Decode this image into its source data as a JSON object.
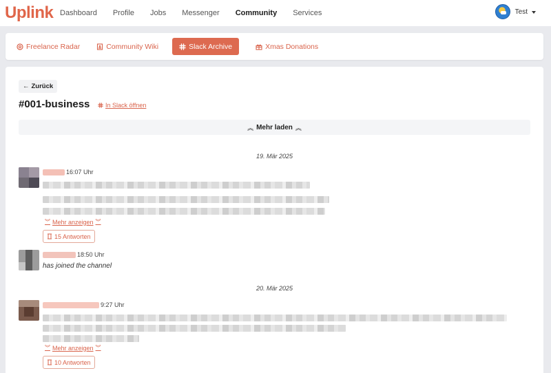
{
  "app": {
    "logo": "Uplink"
  },
  "nav": {
    "links": [
      "Dashboard",
      "Profile",
      "Jobs",
      "Messenger",
      "Community",
      "Services"
    ],
    "active": "Community",
    "user_name": "Test"
  },
  "tabs": [
    {
      "label": "Freelance Radar",
      "icon": "target-icon"
    },
    {
      "label": "Community Wiki",
      "icon": "book-icon"
    },
    {
      "label": "Slack Archive",
      "icon": "slack-icon",
      "active": true
    },
    {
      "label": "Xmas Donations",
      "icon": "gift-icon"
    }
  ],
  "page": {
    "back_label": "Zurück",
    "channel": "#001-business",
    "open_in_slack": "In Slack öffnen",
    "load_more": "Mehr laden"
  },
  "dates": [
    "19. Mär 2025",
    "20. Mär 2025"
  ],
  "messages": [
    {
      "time": "16:07 Uhr",
      "show_more": "Mehr anzeigen",
      "replies": "15 Antworten"
    },
    {
      "time": "18:50 Uhr",
      "text": "has joined the channel"
    },
    {
      "time": "9:27 Uhr",
      "show_more": "Mehr anzeigen",
      "replies": "10 Antworten"
    }
  ],
  "colors": {
    "accent": "#dd6a50",
    "background": "#e9eaee"
  }
}
